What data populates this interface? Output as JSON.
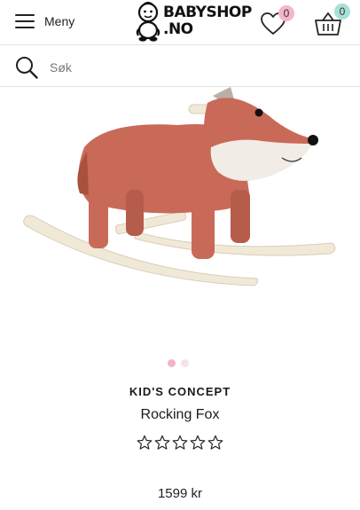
{
  "header": {
    "menu_label": "Meny",
    "logo_line1": "BABYSHOP",
    "logo_line2": ".NO",
    "favorites_count": "0",
    "cart_count": "0"
  },
  "search": {
    "placeholder": "Søk"
  },
  "colors": {
    "favorites_badge": "#f4b6cc",
    "cart_badge": "#a8e0d8",
    "active_dot": "#f2b3c8",
    "inactive_dot": "#f6e3ea",
    "fox_body": "#c96a58",
    "fox_white": "#f1ece6",
    "rocker_wood": "#f1e9d8"
  },
  "icons": {
    "menu": "hamburger-icon",
    "favorites": "heart-icon",
    "cart": "basket-icon",
    "search": "search-icon",
    "rating": "star-outline-icon"
  },
  "product": {
    "brand": "KID'S CONCEPT",
    "name": "Rocking Fox",
    "rating": 0,
    "rating_max": 5,
    "price": "1599 kr",
    "image_count": 2,
    "active_image": 1
  }
}
